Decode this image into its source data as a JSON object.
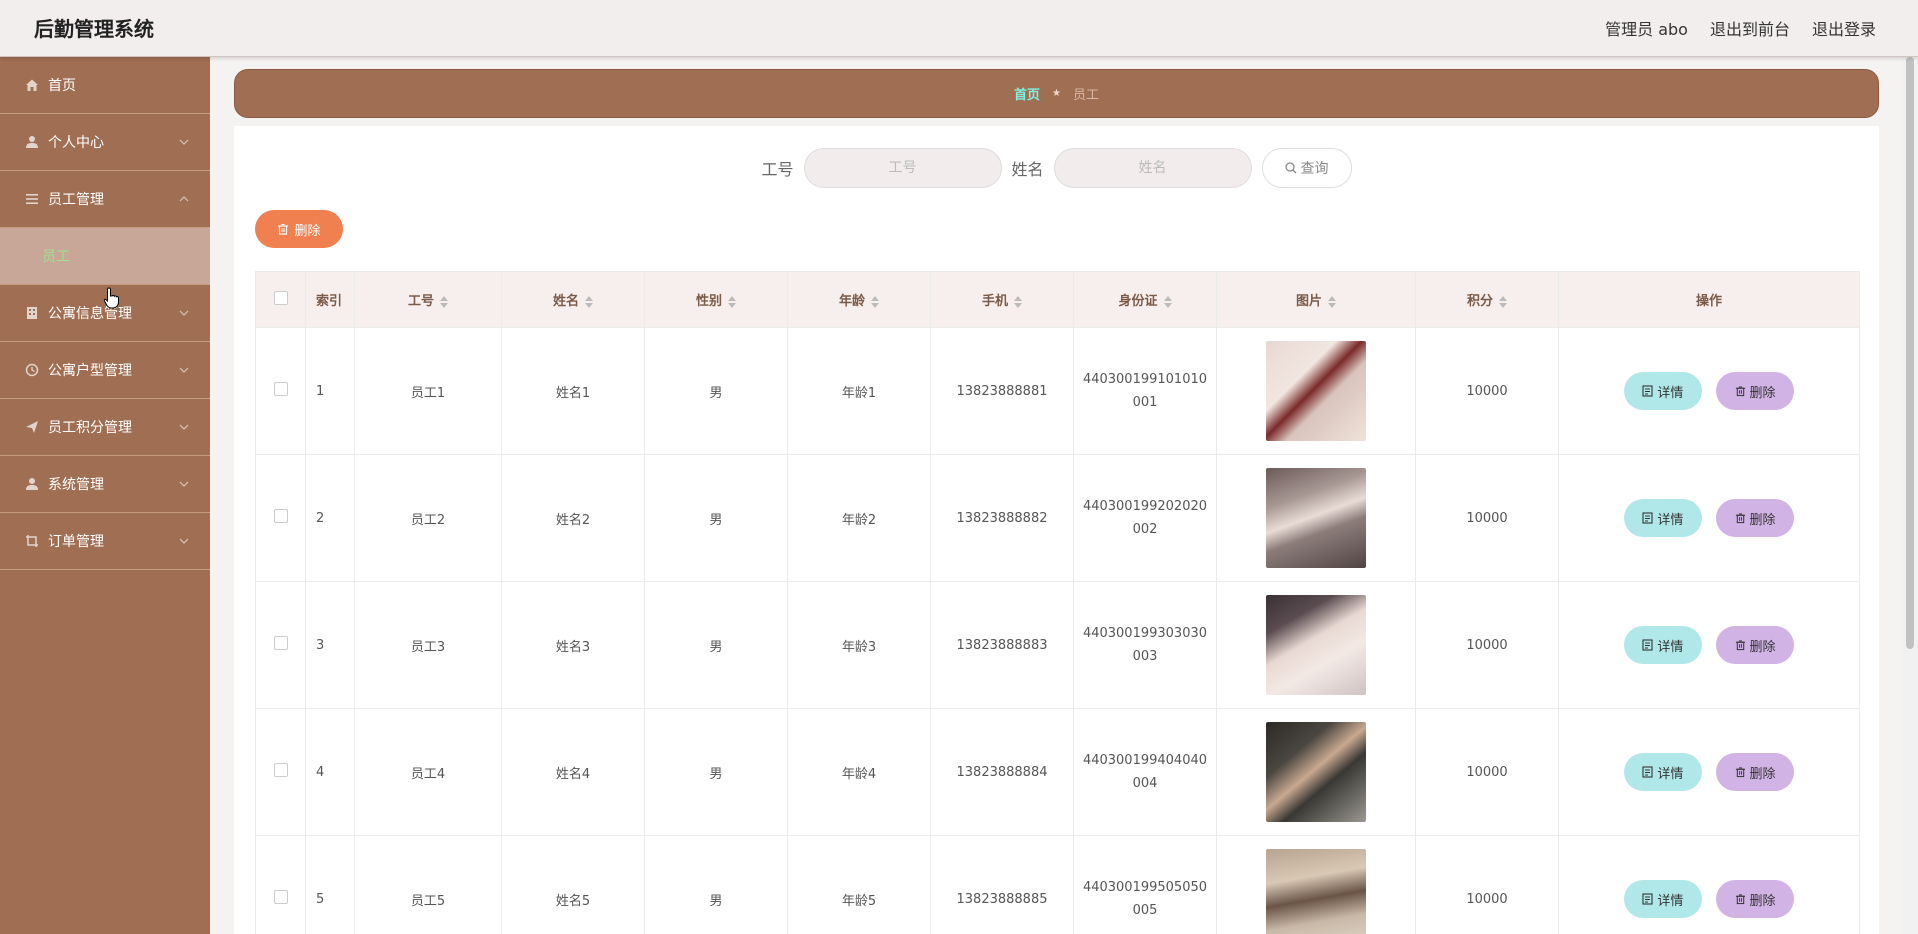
{
  "header": {
    "title": "后勤管理系统",
    "user": "管理员 abo",
    "frontend_link": "退出到前台",
    "logout_link": "退出登录"
  },
  "sidebar": {
    "items": [
      {
        "label": "首页",
        "icon": "home-icon"
      },
      {
        "label": "个人中心",
        "icon": "user-icon"
      },
      {
        "label": "员工管理",
        "icon": "list-icon",
        "expanded": true,
        "children": [
          {
            "label": "员工"
          }
        ]
      },
      {
        "label": "公寓信息管理",
        "icon": "building-icon"
      },
      {
        "label": "公寓户型管理",
        "icon": "clock-icon"
      },
      {
        "label": "员工积分管理",
        "icon": "send-icon"
      },
      {
        "label": "系统管理",
        "icon": "user-icon"
      },
      {
        "label": "订单管理",
        "icon": "crop-icon"
      }
    ],
    "colors": {
      "bg": "#a06e52",
      "active_text": "#9fe08e"
    }
  },
  "breadcrumb": {
    "home": "首页",
    "separator": "★",
    "current": "员工"
  },
  "search": {
    "field1_label": "工号",
    "field1_placeholder": "工号",
    "field2_label": "姓名",
    "field2_placeholder": "姓名",
    "button_label": "查询"
  },
  "toolbar": {
    "delete_label": "删除"
  },
  "table": {
    "columns": {
      "index": "索引",
      "job_no": "工号",
      "name": "姓名",
      "gender": "性别",
      "age": "年龄",
      "phone": "手机",
      "id_card": "身份证",
      "photo": "图片",
      "points": "积分",
      "actions": "操作"
    },
    "rows": [
      {
        "index": "1",
        "job_no": "员工1",
        "name": "姓名1",
        "gender": "男",
        "age": "年龄1",
        "phone": "13823888881",
        "id_card": "440300199101010001",
        "points": "10000"
      },
      {
        "index": "2",
        "job_no": "员工2",
        "name": "姓名2",
        "gender": "男",
        "age": "年龄2",
        "phone": "13823888882",
        "id_card": "440300199202020002",
        "points": "10000"
      },
      {
        "index": "3",
        "job_no": "员工3",
        "name": "姓名3",
        "gender": "男",
        "age": "年龄3",
        "phone": "13823888883",
        "id_card": "440300199303030003",
        "points": "10000"
      },
      {
        "index": "4",
        "job_no": "员工4",
        "name": "姓名4",
        "gender": "男",
        "age": "年龄4",
        "phone": "13823888884",
        "id_card": "440300199404040004",
        "points": "10000"
      },
      {
        "index": "5",
        "job_no": "员工5",
        "name": "姓名5",
        "gender": "男",
        "age": "年龄5",
        "phone": "13823888885",
        "id_card": "440300199505050005",
        "points": "10000"
      }
    ],
    "detail_label": "详情",
    "delete_label": "删除"
  }
}
